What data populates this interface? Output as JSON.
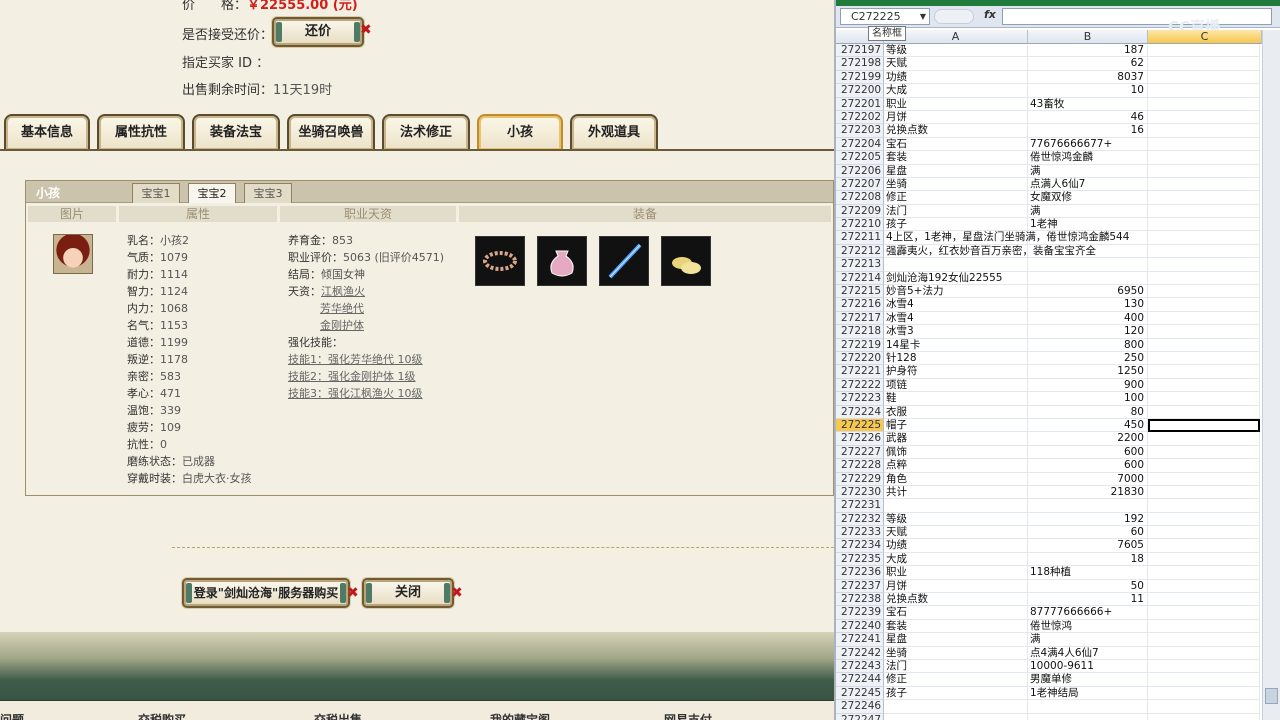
{
  "game": {
    "price_label": "价　　格：",
    "price_value": "￥22555.00 (元)",
    "bargain_label": "是否接受还价：",
    "bargain_button": "还价",
    "buyer_label": "指定买家 ID ：",
    "remaining_label": "出售剩余时间：",
    "remaining_value": "11天19时",
    "tabs": [
      "基本信息",
      "属性抗性",
      "装备法宝",
      "坐骑召唤兽",
      "法术修正",
      "小孩",
      "外观道具"
    ],
    "active_tab": "小孩",
    "box_title": "小孩",
    "subtabs": [
      "宝宝1",
      "宝宝2",
      "宝宝3"
    ],
    "active_subtab": "宝宝2",
    "columns": [
      "图片",
      "属性",
      "职业天资",
      "装备"
    ],
    "attributes": [
      {
        "label": "乳名：",
        "value": "小孩2"
      },
      {
        "label": "气质：",
        "value": "1079"
      },
      {
        "label": "耐力：",
        "value": "1114"
      },
      {
        "label": "智力：",
        "value": "1124"
      },
      {
        "label": "内力：",
        "value": "1068"
      },
      {
        "label": "名气：",
        "value": "1153"
      },
      {
        "label": "道德：",
        "value": "1199"
      },
      {
        "label": "叛逆：",
        "value": "1178"
      },
      {
        "label": "亲密：",
        "value": "583"
      },
      {
        "label": "孝心：",
        "value": "471"
      },
      {
        "label": "温饱：",
        "value": "339"
      },
      {
        "label": "疲劳：",
        "value": "109"
      },
      {
        "label": "抗性：",
        "value": "0"
      },
      {
        "label": "磨练状态：",
        "value": "已成器"
      },
      {
        "label": "穿戴时装：",
        "value": "白虎大衣·女孩"
      }
    ],
    "career": {
      "fund_label": "养育金：",
      "fund_value": "853",
      "eval_label": "职业评价：",
      "eval_value": "5063 (旧评价4571)",
      "ending_label": "结局：",
      "ending_value": "倾国女神",
      "talent_label": "天资：",
      "talents": [
        "江枫渔火",
        "芳华绝代",
        "金刚护体"
      ],
      "skills_label": "强化技能：",
      "skills": [
        "技能1：强化芳华绝代 10级",
        "技能2：强化金刚护体 1级",
        "技能3：强化江枫渔火 10级"
      ]
    },
    "login_button": "登录\"剑灿沧海\"服务器购买",
    "close_button": "关闭",
    "bottom_items": [
      "问题",
      "交税购买",
      "交税出售",
      "我的藏宝阁",
      "网易支付"
    ]
  },
  "excel": {
    "name_box": "C272225",
    "tooltip": "名称框",
    "fx": "fx",
    "watermark": "CC直播",
    "col_headers": [
      "A",
      "B",
      "C"
    ],
    "rows": [
      {
        "n": "272197",
        "a": "等级",
        "b": "187"
      },
      {
        "n": "272198",
        "a": "天赋",
        "b": "62"
      },
      {
        "n": "272199",
        "a": "功绩",
        "b": "8037"
      },
      {
        "n": "272200",
        "a": "大成",
        "b": "10"
      },
      {
        "n": "272201",
        "a": "职业",
        "b": "43畜牧",
        "bl": true
      },
      {
        "n": "272202",
        "a": "月饼",
        "b": "46"
      },
      {
        "n": "272203",
        "a": "兑换点数",
        "b": "16"
      },
      {
        "n": "272204",
        "a": "宝石",
        "b": "77676666677+",
        "bl": true
      },
      {
        "n": "272205",
        "a": "套装",
        "b": "倦世惊鸿金麟",
        "bl": true
      },
      {
        "n": "272206",
        "a": "星盘",
        "b": "满",
        "bl": true
      },
      {
        "n": "272207",
        "a": "坐骑",
        "b": "点满人6仙7",
        "bl": true
      },
      {
        "n": "272208",
        "a": "修正",
        "b": "女魔双修",
        "bl": true
      },
      {
        "n": "272209",
        "a": "法门",
        "b": "满",
        "bl": true
      },
      {
        "n": "272210",
        "a": "孩子",
        "b": "1老神",
        "bl": true
      },
      {
        "n": "272211",
        "a": "4上区，1老神，星盘法门坐骑满，倦世惊鸿金麟544",
        "b": ""
      },
      {
        "n": "272212",
        "a": "强霹夷火，红衣妙音百万亲密，装备宝宝齐全",
        "b": ""
      },
      {
        "n": "272213",
        "a": "",
        "b": ""
      },
      {
        "n": "272214",
        "a": "剑灿沧海192女仙22555",
        "b": ""
      },
      {
        "n": "272215",
        "a": "妙音5+法力",
        "b": "6950"
      },
      {
        "n": "272216",
        "a": "冰雪4",
        "b": "130"
      },
      {
        "n": "272217",
        "a": "冰雪4",
        "b": "400"
      },
      {
        "n": "272218",
        "a": "冰雪3",
        "b": "120"
      },
      {
        "n": "272219",
        "a": "14星卡",
        "b": "800"
      },
      {
        "n": "272220",
        "a": "针128",
        "b": "250"
      },
      {
        "n": "272221",
        "a": "护身符",
        "b": "1250"
      },
      {
        "n": "272222",
        "a": "项链",
        "b": "900"
      },
      {
        "n": "272223",
        "a": "鞋",
        "b": "100"
      },
      {
        "n": "272224",
        "a": "衣服",
        "b": "80"
      },
      {
        "n": "272225",
        "a": "帽子",
        "b": "450",
        "sel": true
      },
      {
        "n": "272226",
        "a": "武器",
        "b": "2200"
      },
      {
        "n": "272227",
        "a": "佩饰",
        "b": "600"
      },
      {
        "n": "272228",
        "a": "点粹",
        "b": "600"
      },
      {
        "n": "272229",
        "a": "角色",
        "b": "7000"
      },
      {
        "n": "272230",
        "a": "共计",
        "b": "21830"
      },
      {
        "n": "272231",
        "a": "",
        "b": ""
      },
      {
        "n": "272232",
        "a": "等级",
        "b": "192"
      },
      {
        "n": "272233",
        "a": "天赋",
        "b": "60"
      },
      {
        "n": "272234",
        "a": "功绩",
        "b": "7605"
      },
      {
        "n": "272235",
        "a": "大成",
        "b": "18"
      },
      {
        "n": "272236",
        "a": "职业",
        "b": "118种植",
        "bl": true
      },
      {
        "n": "272237",
        "a": "月饼",
        "b": "50"
      },
      {
        "n": "272238",
        "a": "兑换点数",
        "b": "11"
      },
      {
        "n": "272239",
        "a": "宝石",
        "b": "87777666666+",
        "bl": true
      },
      {
        "n": "272240",
        "a": "套装",
        "b": "倦世惊鸿",
        "bl": true
      },
      {
        "n": "272241",
        "a": "星盘",
        "b": "满",
        "bl": true
      },
      {
        "n": "272242",
        "a": "坐骑",
        "b": "点4满4人6仙7",
        "bl": true
      },
      {
        "n": "272243",
        "a": "法门",
        "b": "10000-9611",
        "bl": true
      },
      {
        "n": "272244",
        "a": "修正",
        "b": "男魔单修",
        "bl": true
      },
      {
        "n": "272245",
        "a": "孩子",
        "b": "1老神结局",
        "bl": true
      },
      {
        "n": "272246",
        "a": "",
        "b": ""
      },
      {
        "n": "272247",
        "a": "",
        "b": ""
      }
    ]
  }
}
